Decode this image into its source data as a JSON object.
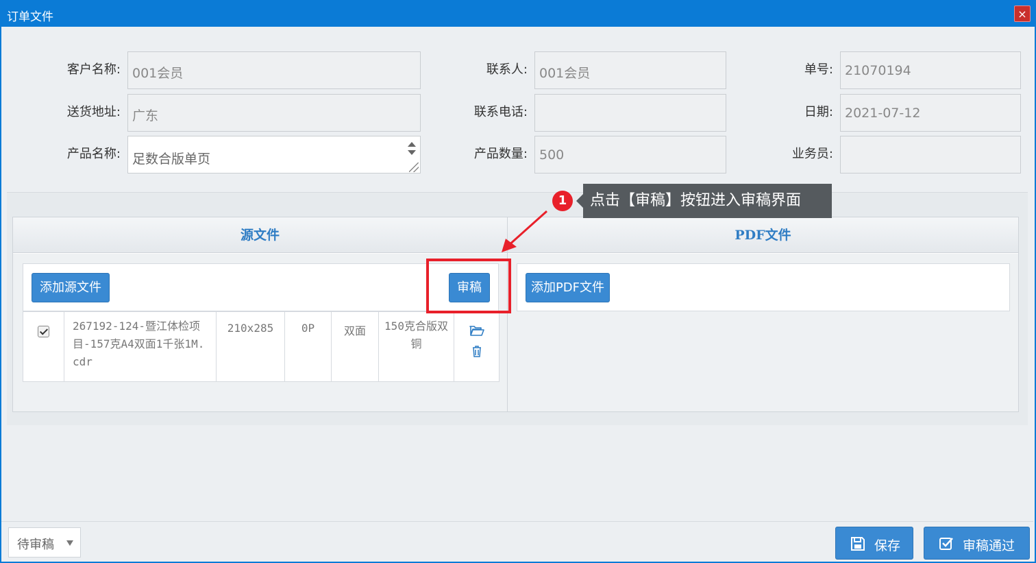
{
  "window": {
    "title": "订单文件",
    "close_glyph": "×"
  },
  "form": {
    "customer_label": "客户名称:",
    "customer_value": "001会员",
    "contact_label": "联系人:",
    "contact_value": "001会员",
    "order_no_label": "单号:",
    "order_no_value": "21070194",
    "address_label": "送货地址:",
    "address_value": "广东",
    "phone_label": "联系电话:",
    "phone_value": "",
    "date_label": "日期:",
    "date_value": "2021-07-12",
    "product_label": "产品名称:",
    "product_value": "足数合版单页",
    "quantity_label": "产品数量:",
    "quantity_value": "500",
    "salesman_label": "业务员:",
    "salesman_value": ""
  },
  "files": {
    "source_header": "源文件",
    "pdf_header": "PDF文件",
    "add_source_label": "添加源文件",
    "review_label": "审稿",
    "add_pdf_label": "添加PDF文件",
    "row": {
      "checked": true,
      "filename": "267192-124-暨江体检项目-157克A4双面1千张1M.cdr",
      "size": "210x285",
      "pages": "0P",
      "sides": "双面",
      "paper": "150克合版双铜"
    }
  },
  "annotation": {
    "step_number": "1",
    "tooltip": "点击【审稿】按钮进入审稿界面",
    "color": "#e8202a"
  },
  "footer": {
    "status_value": "待审稿",
    "save_label": "保存",
    "approve_label": "审稿通过"
  },
  "colors": {
    "titlebar": "#0b7bd6",
    "button": "#3a8ad3",
    "link": "#2f7dc4"
  }
}
